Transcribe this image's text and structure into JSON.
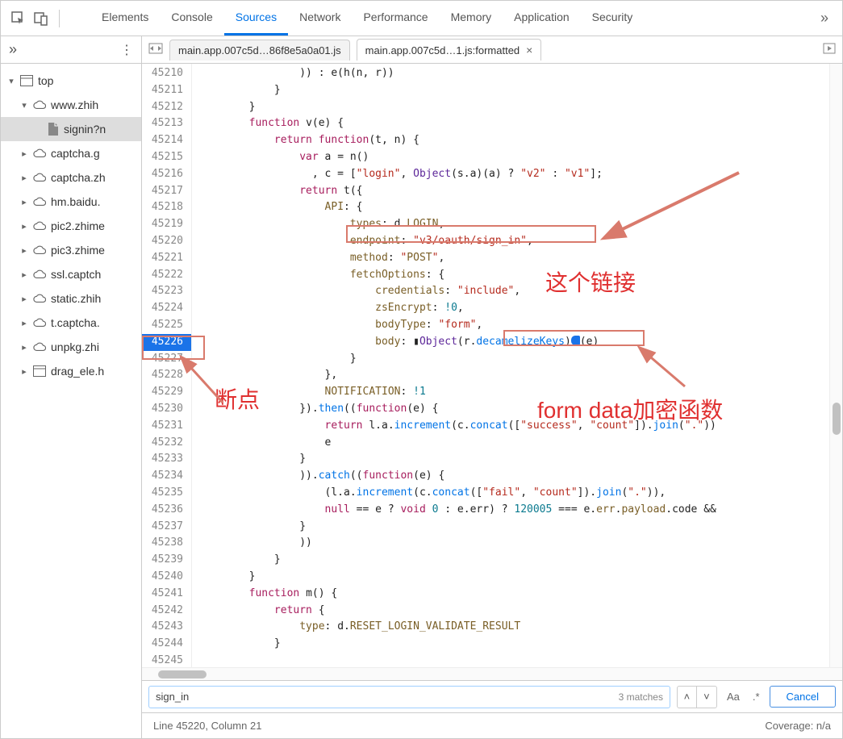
{
  "toolbar": {
    "tabs": [
      "Elements",
      "Console",
      "Sources",
      "Network",
      "Performance",
      "Memory",
      "Application",
      "Security"
    ],
    "active_tab": "Sources"
  },
  "file_tabs": {
    "left_controls": "◂ ▸",
    "tab1": "main.app.007c5d…86f8e5a0a01.js",
    "tab2": "main.app.007c5d…1.js:formatted",
    "active": 1
  },
  "file_tree": {
    "items": [
      {
        "depth": 0,
        "chev": "▾",
        "icon": "window",
        "label": "top"
      },
      {
        "depth": 1,
        "chev": "▾",
        "icon": "cloud",
        "label": "www.zhih"
      },
      {
        "depth": 2,
        "chev": "",
        "icon": "file",
        "label": "signin?n",
        "selected": true
      },
      {
        "depth": 1,
        "chev": "▸",
        "icon": "cloud",
        "label": "captcha.g"
      },
      {
        "depth": 1,
        "chev": "▸",
        "icon": "cloud",
        "label": "captcha.zh"
      },
      {
        "depth": 1,
        "chev": "▸",
        "icon": "cloud",
        "label": "hm.baidu."
      },
      {
        "depth": 1,
        "chev": "▸",
        "icon": "cloud",
        "label": "pic2.zhime"
      },
      {
        "depth": 1,
        "chev": "▸",
        "icon": "cloud",
        "label": "pic3.zhime"
      },
      {
        "depth": 1,
        "chev": "▸",
        "icon": "cloud",
        "label": "ssl.captch"
      },
      {
        "depth": 1,
        "chev": "▸",
        "icon": "cloud",
        "label": "static.zhih"
      },
      {
        "depth": 1,
        "chev": "▸",
        "icon": "cloud",
        "label": "t.captcha."
      },
      {
        "depth": 1,
        "chev": "▸",
        "icon": "cloud",
        "label": "unpkg.zhi"
      },
      {
        "depth": 1,
        "chev": "▸",
        "icon": "window",
        "label": "drag_ele.h"
      }
    ]
  },
  "code": {
    "first_line": 45210,
    "breakpoint_line": 45226,
    "lines": [
      "                )) : e(h(n, r))",
      "            }",
      "        }",
      "        function v(e) {",
      "            return function(t, n) {",
      "                var a = n()",
      "                  , c = [\"login\", Object(s.a)(a) ? \"v2\" : \"v1\"];",
      "                return t({",
      "                    API: {",
      "                        types: d.LOGIN,",
      "                        endpoint: \"v3/oauth/sign_in\",",
      "                        method: \"POST\",",
      "                        fetchOptions: {",
      "                            credentials: \"include\",",
      "                            zsEncrypt: !0,",
      "                            bodyType: \"form\",",
      "                            body: ▮Object(r.decamelizeKeys)▮(e)",
      "                        }",
      "                    },",
      "                    NOTIFICATION: !1",
      "                }).then((function(e) {",
      "                    return l.a.increment(c.concat([\"success\", \"count\"]).join(\".\"))",
      "                    e",
      "                }",
      "                )).catch((function(e) {",
      "                    (l.a.increment(c.concat([\"fail\", \"count\"]).join(\".\")),",
      "                    null == e ? void 0 : e.err) ? 120005 === e.err.payload.code &&",
      "                }",
      "                ))",
      "            }",
      "        }",
      "        function m() {",
      "            return {",
      "                type: d.RESET_LOGIN_VALIDATE_RESULT",
      "            }",
      ""
    ]
  },
  "search": {
    "query": "sign_in",
    "matches": "3 matches",
    "case_label": "Aa",
    "regex_label": ".*",
    "cancel": "Cancel"
  },
  "status": {
    "left": "Line 45220, Column 21",
    "right": "Coverage: n/a"
  },
  "annotations": {
    "breakpoint_label": "断点",
    "link_label": "这个链接",
    "formdata_label": "form data加密函数"
  }
}
